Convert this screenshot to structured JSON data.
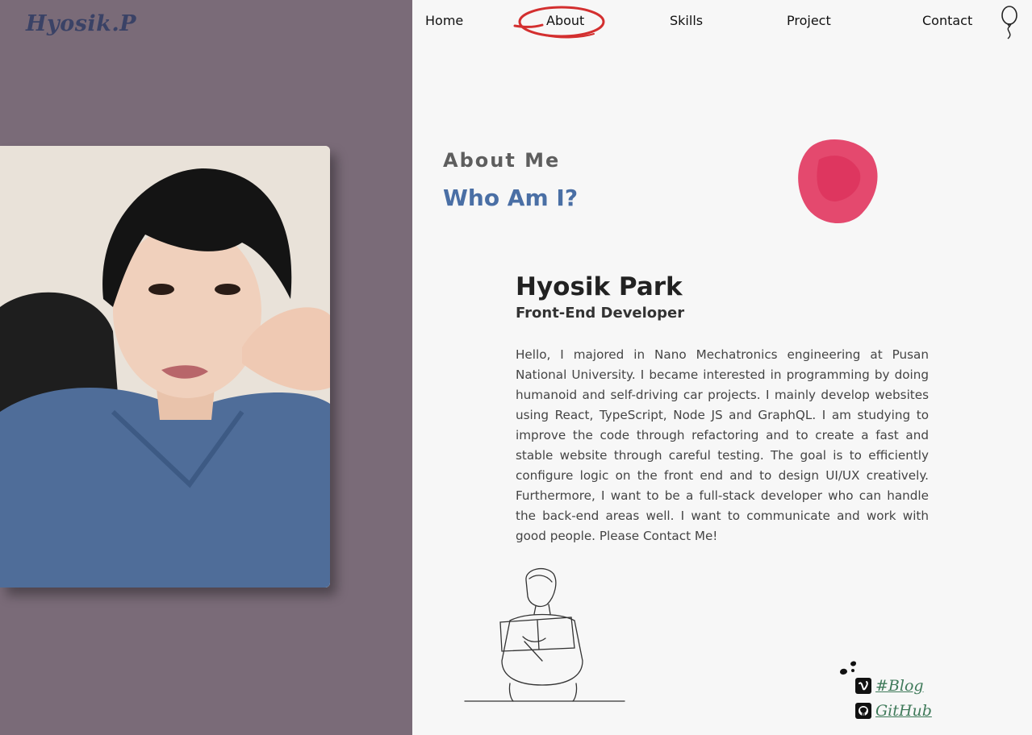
{
  "brand": {
    "logo": "Hyosik.P"
  },
  "nav": {
    "items": [
      {
        "label": "Home"
      },
      {
        "label": "About",
        "active": true
      },
      {
        "label": "Skills"
      },
      {
        "label": "Project"
      },
      {
        "label": "Contact"
      }
    ],
    "theme_icon": "balloon-icon"
  },
  "about": {
    "eyebrow": "About Me",
    "title": "Who Am I?",
    "name": "Hyosik Park",
    "role": "Front-End Developer",
    "bio": "Hello, I majored in Nano Mechatronics engineering at Pusan National University. I became interested in programming by doing humanoid and self-driving car projects. I mainly develop websites using React, TypeScript, Node JS and GraphQL. I am studying to improve the code through refactoring and to create a fast and stable website through careful testing. The goal is to efficiently configure logic on the front end and to design UI/UX creatively. Furthermore, I want to be a full-stack developer who can handle the back-end areas well. I want to communicate and work with good people. Please Contact Me!"
  },
  "links": [
    {
      "label": "#Blog",
      "icon": "vimeo-icon"
    },
    {
      "label": "GitHub",
      "icon": "github-icon"
    }
  ],
  "colors": {
    "left_panel": "#7a6b78",
    "right_panel": "#f7f7f7",
    "title_blue": "#4a6fa5",
    "active_circle": "#d32f2f",
    "paint_blob": "#e23a62",
    "link_green": "#3f7a5a"
  }
}
